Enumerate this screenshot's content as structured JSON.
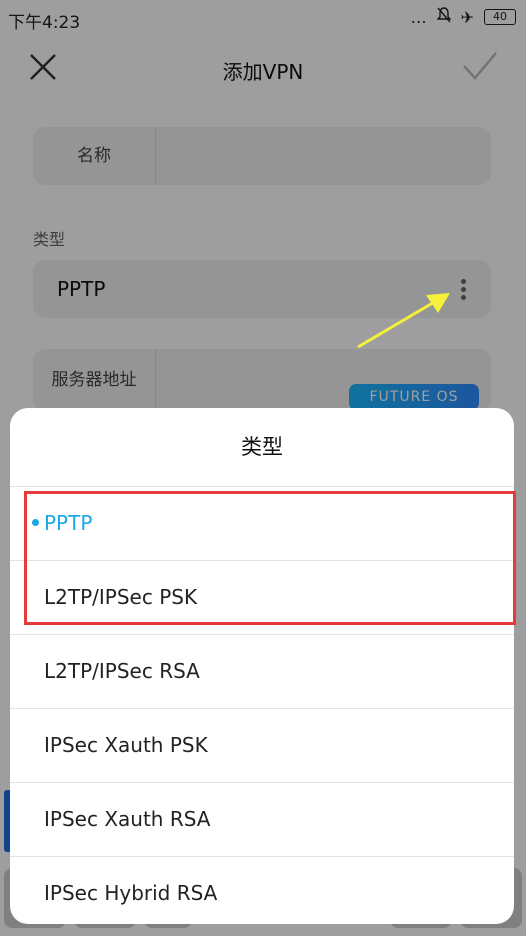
{
  "status": {
    "time": "下午4:23",
    "battery": "40"
  },
  "header": {
    "title": "添加VPN"
  },
  "form": {
    "name_label": "名称",
    "type_caption": "类型",
    "type_value": "PPTP",
    "server_label": "服务器地址"
  },
  "watermark": "FUTURE OS",
  "sheet": {
    "title": "类型",
    "options": [
      {
        "label": "PPTP",
        "selected": true
      },
      {
        "label": "L2TP/IPSec PSK",
        "selected": false
      },
      {
        "label": "L2TP/IPSec RSA",
        "selected": false
      },
      {
        "label": "IPSec Xauth PSK",
        "selected": false
      },
      {
        "label": "IPSec Xauth RSA",
        "selected": false
      },
      {
        "label": "IPSec Hybrid RSA",
        "selected": false
      }
    ]
  },
  "colors": {
    "accent": "#1aa7e8",
    "highlight": "#e53b3b",
    "arrow": "#f5f03a"
  }
}
